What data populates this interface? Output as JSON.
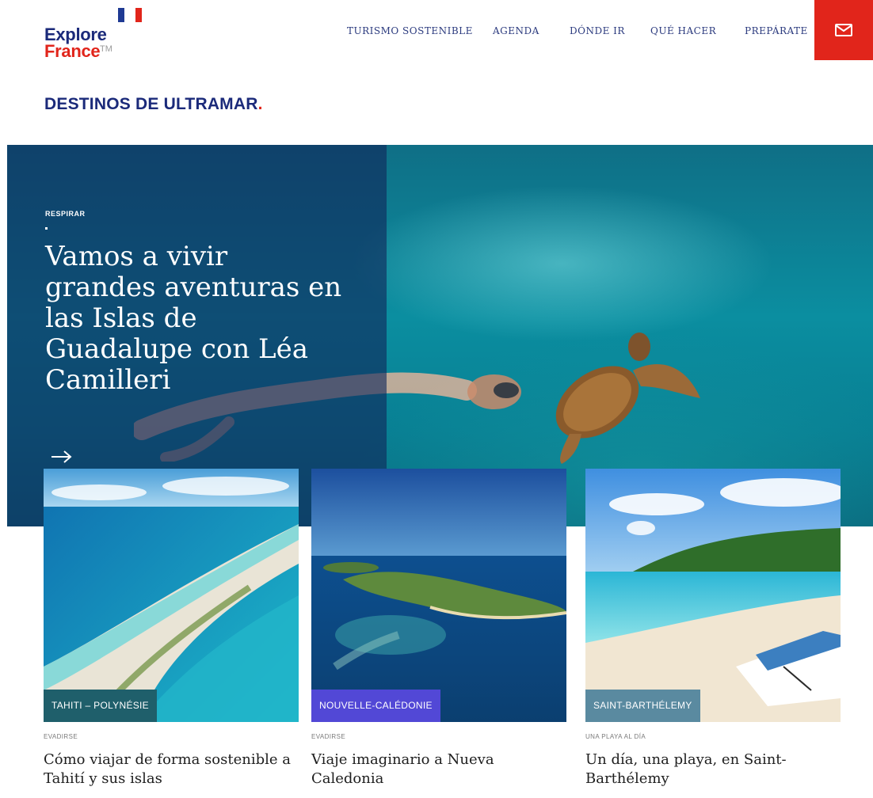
{
  "brand": {
    "logo_line1": "Explore",
    "logo_line2": "France",
    "logo_tm": "TM",
    "colors": {
      "navy": "#1b2a7a",
      "red": "#e1251b",
      "flag_blue": "#1f3a93",
      "flag_white": "#ffffff"
    }
  },
  "nav": {
    "items": [
      "TURISMO SOSTENIBLE",
      "AGENDA",
      "DÓNDE IR",
      "QUÉ HACER",
      "PREPÁRATE"
    ],
    "contact_icon": "mail-icon"
  },
  "section": {
    "title": "DESTINOS DE ULTRAMAR",
    "title_dot": "."
  },
  "hero": {
    "tag": "RESPIRAR",
    "title": "Vamos a vivir grandes aventuras en las Islas de Guadalupe con Léa Camilleri",
    "arrow": "→"
  },
  "cards": [
    {
      "badge": "TAHITI – POLYNÉSIE",
      "badge_color": "#1f5f6b",
      "category": "EVADIRSE",
      "title": "Cómo viajar de forma sostenible a Tahití y sus islas"
    },
    {
      "badge": "NOUVELLE-CALÉDONIE",
      "badge_color": "#5248d6",
      "category": "EVADIRSE",
      "title": "Viaje imaginario a Nueva Caledonia"
    },
    {
      "badge": "SAINT-BARTHÉLEMY",
      "badge_color": "#5a8aa0",
      "category": "UNA PLAYA AL DÍA",
      "title": "Un día, una playa, en Saint-Barthélemy"
    }
  ]
}
